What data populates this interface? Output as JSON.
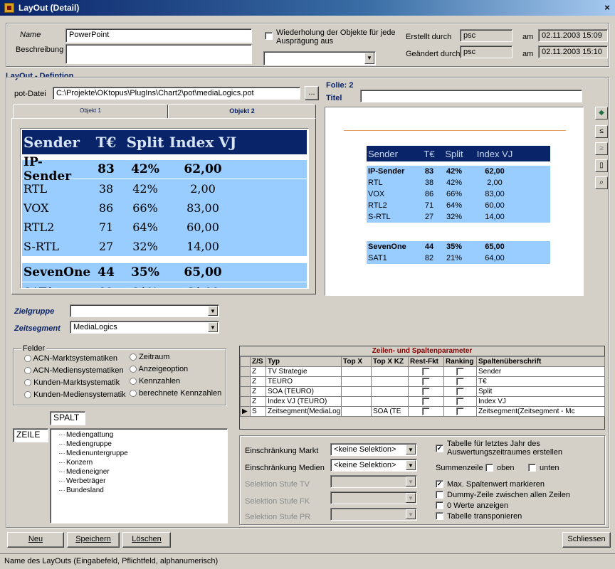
{
  "window": {
    "title": "LayOut (Detail)",
    "close": "×"
  },
  "header": {
    "name_label": "Name",
    "name_value": "PowerPoint",
    "desc_label": "Beschreibung",
    "repeat_label": "Wiederholung der Objekte für jede Ausprägung aus",
    "created_label": "Erstellt durch",
    "created_by": "psc",
    "created_am": "am",
    "created_date": "02.11.2003 15:09",
    "changed_label": "Geändert durch",
    "changed_by": "psc",
    "changed_am": "am",
    "changed_date": "02.11.2003 15:10"
  },
  "definition": {
    "section_label": "LayOut - Defintion",
    "pot_label": "pot-Datei",
    "pot_path": "C:\\Projekte\\OKtopus\\PlugIns\\Chart2\\pot\\mediaLogics.pot",
    "browse": "...",
    "folie_label": "Folie: 2",
    "titel_label": "Titel",
    "titel_value": ""
  },
  "tabs": [
    {
      "label": "Objekt 1"
    },
    {
      "label": "Objekt 2"
    }
  ],
  "big_table": {
    "headers": [
      "Sender",
      "T€",
      "Split",
      "Index VJ"
    ],
    "group1": [
      [
        "IP-Sender",
        "83",
        "42%",
        "62,00"
      ],
      [
        "RTL",
        "38",
        "42%",
        "2,00"
      ],
      [
        "VOX",
        "86",
        "66%",
        "83,00"
      ],
      [
        "RTL2",
        "71",
        "64%",
        "60,00"
      ],
      [
        "S-RTL",
        "27",
        "32%",
        "14,00"
      ]
    ],
    "group2": [
      [
        "SevenOne",
        "44",
        "35%",
        "65,00"
      ],
      [
        "SAT1",
        "82",
        "21%",
        "64,00"
      ]
    ]
  },
  "side_icons": [
    {
      "name": "chart-icon",
      "glyph": "◆"
    },
    {
      "name": "prev-icon",
      "glyph": "≤"
    },
    {
      "name": "next-icon",
      "glyph": "≥"
    },
    {
      "name": "new-page-icon",
      "glyph": "▯"
    },
    {
      "name": "preview-icon",
      "glyph": "🔍"
    }
  ],
  "zielgruppe": {
    "label": "Zielgruppe",
    "value": ""
  },
  "zeitsegment": {
    "label": "Zeitsegment",
    "value": "MediaLogics"
  },
  "felder": {
    "label": "Felder",
    "options": [
      "ACN-Marktsystematiken",
      "ACN-Mediensystematiken",
      "Kunden-Marktsystematik",
      "Kunden-Mediensystematik",
      "Zeitraum",
      "Anzeigeoption",
      "Kennzahlen",
      "berechnete Kennzahlen"
    ]
  },
  "spalt_label": "SPALT",
  "zeile_label": "ZEILE",
  "tree_items": [
    "Mediengattung",
    "Mediengruppe",
    "Medienuntergruppe",
    "Konzern",
    "Medieneigner",
    "Werbeträger",
    "Bundesland"
  ],
  "params": {
    "title": "Zeilen- und Spaltenparameter",
    "columns": [
      "Z/S",
      "Typ",
      "Top X",
      "Top X KZ",
      "Rest-Fkt",
      "Ranking",
      "Spaltenüberschrift"
    ],
    "rows": [
      [
        "Z",
        "TV Strategie",
        "",
        "",
        "",
        "",
        "Sender"
      ],
      [
        "Z",
        "TEURO",
        "",
        "",
        "",
        "",
        "T€"
      ],
      [
        "Z",
        "SOA (TEURO)",
        "",
        "",
        "",
        "",
        "Split"
      ],
      [
        "Z",
        "Index VJ (TEURO)",
        "",
        "",
        "",
        "",
        "Index VJ"
      ],
      [
        "S",
        "Zeitsegment(MediaLog",
        "",
        "SOA (TE",
        "",
        "",
        "Zeitsegment(Zeitsegment - Mc"
      ]
    ],
    "current_marker": "▶"
  },
  "restrictions": {
    "markt_label": "Einschränkung Markt",
    "markt_value": "<keine Selektion>",
    "medien_label": "Einschränkung Medien",
    "medien_value": "<keine Selektion>",
    "tv_label": "Selektion Stufe TV",
    "fk_label": "Selektion Stufe FK",
    "pr_label": "Selektion Stufe PR"
  },
  "options": {
    "last_year": "Tabelle für letztes Jahr des Auswertungszeitraumes erstellen",
    "summen": "Summenzeile",
    "oben": "oben",
    "unten": "unten",
    "max": "Max. Spaltenwert markieren",
    "dummy": "Dummy-Zeile zwischen allen Zeilen",
    "null": "0 Werte anzeigen",
    "transpose": "Tabelle transponieren"
  },
  "buttons": {
    "neu": "Neu",
    "speichern": "Speichern",
    "loeschen": "Löschen",
    "schliessen": "Schliessen"
  },
  "status": "Name des LayOuts (Eingabefeld, Pflichtfeld, alphanumerisch)",
  "colors": {
    "accent": "#0a246a",
    "row_blue": "#99ccff",
    "header_bg": "#0a246a",
    "params_title": "#800000"
  }
}
